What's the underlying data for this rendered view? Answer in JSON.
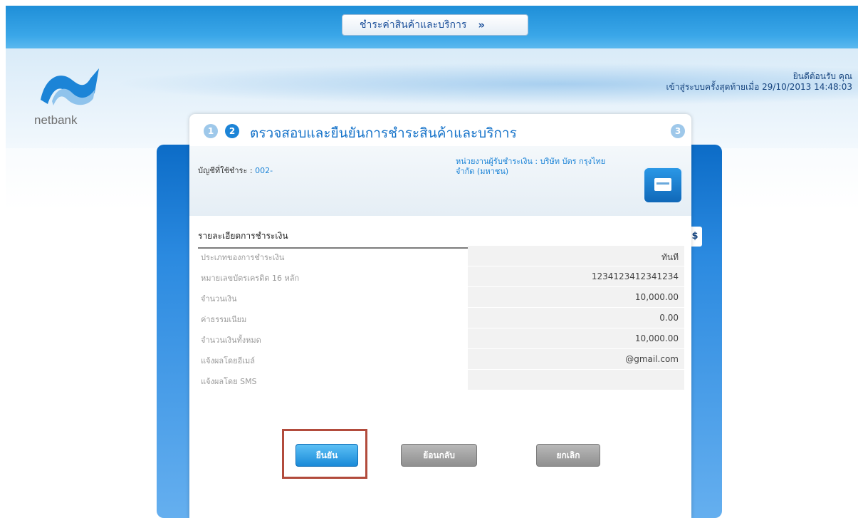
{
  "topbar": {
    "menu_label": "ชำระค่าสินค้าและบริการ",
    "chevron_icon": "double-chevron-down-icon"
  },
  "brand": {
    "logo_text": "netbank"
  },
  "welcome": {
    "greeting": "ยินดีต้อนรับ คุณ",
    "user_name": "",
    "last_login_label": "เข้าสู่ระบบครั้งสุดท้ายเมื่อ",
    "last_login_time": "29/10/2013 14:48:03"
  },
  "steps": {
    "step1": "1",
    "step2": "2",
    "step3": "3"
  },
  "page_title": "ตรวจสอบและยืนยันการชำระสินค้าและบริการ",
  "account": {
    "label": "บัญชีที่ใช้ชำระ :",
    "number": "002-"
  },
  "payee": {
    "label": "หน่วยงานผู้รับชำระเงิน :",
    "name": "บริษัท บัตร กรุงไทย จำกัด (มหาชน)"
  },
  "details": {
    "title": "รายละเอียดการชำระเงิน",
    "rows": [
      {
        "label": "ประเภทของการชำระเงิน",
        "value": "ทันที"
      },
      {
        "label": "หมายเลขบัตรเครดิต 16 หลัก",
        "value": "1234123412341234"
      },
      {
        "label": "จำนวนเงิน",
        "value": "10,000.00"
      },
      {
        "label": "ค่าธรรมเนียม",
        "value": "0.00"
      },
      {
        "label": "จำนวนเงินทั้งหมด",
        "value": "10,000.00"
      },
      {
        "label": "แจ้งผลโดยอีเมล์",
        "value": "@gmail.com"
      },
      {
        "label": "แจ้งผลโดย SMS",
        "value": ""
      }
    ]
  },
  "buttons": {
    "confirm": "ยืนยัน",
    "back": "ย้อนกลับ",
    "cancel": "ยกเลิก"
  },
  "colors": {
    "primary_blue": "#1c84d7",
    "highlight_red": "#b24b3c"
  }
}
